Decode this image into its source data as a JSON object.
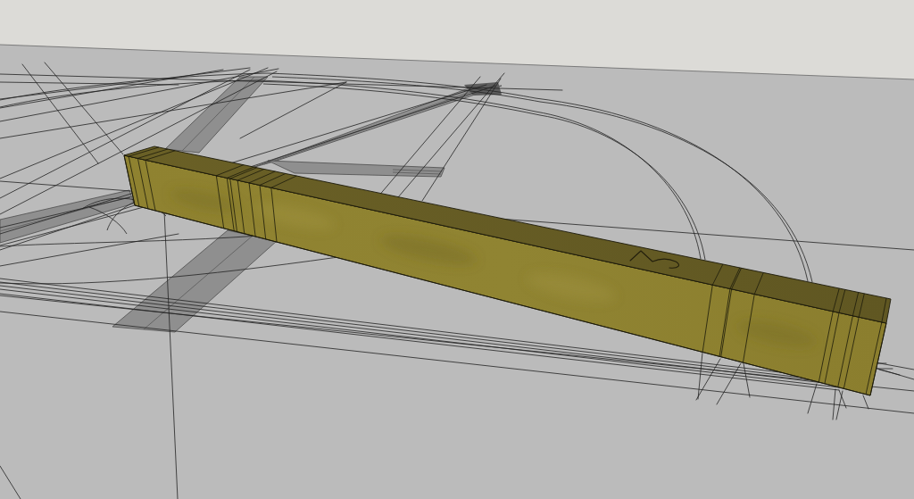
{
  "viewport": {
    "items": [
      {
        "kind": "sky"
      },
      {
        "kind": "ground"
      },
      {
        "kind": "strip"
      },
      {
        "kind": "strip"
      },
      {
        "kind": "strip"
      },
      {
        "kind": "strip"
      },
      {
        "kind": "strip"
      },
      {
        "kind": "lines"
      },
      {
        "kind": "beam",
        "marked": true
      }
    ]
  }
}
